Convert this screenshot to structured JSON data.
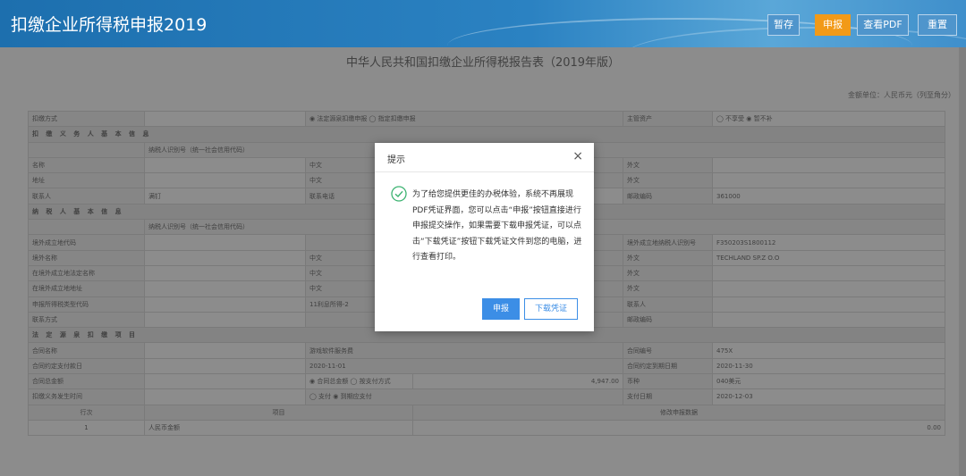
{
  "app": {
    "title": "扣缴企业所得税申报2019"
  },
  "toolbar": {
    "save": "暂存",
    "submit": "申报",
    "view_pdf": "查看PDF",
    "reset": "重置"
  },
  "report": {
    "title": "中华人民共和国扣缴企业所得税报告表（2019年版）",
    "unit_note": "金额单位：人民币元（列至角分）",
    "rows": [
      {
        "label": "扣缴方式",
        "mid": "◉ 法定源泉扣缴申报  ◯ 指定扣缴申报",
        "right_label": "主管资产",
        "right_value": "◯ 不享受  ◉ 暂不补"
      },
      {
        "section": "扣 缴 义 务 人 基 本 信 息"
      },
      {
        "sub": "纳税人识别号（统一社会信用代码）"
      },
      {
        "label": "名称",
        "mid": "中文",
        "right_label": "外文",
        "right_value": ""
      },
      {
        "label": "地址",
        "mid": "中文",
        "right_label": "外文",
        "right_value": ""
      },
      {
        "label": "联系人",
        "contact": "满钉",
        "mid": "联系电话",
        "right_label": "邮政编码",
        "right_value": "361000"
      },
      {
        "section": "纳 税 人 基 本 信 息"
      },
      {
        "sub": "纳税人识别号（统一社会信用代码）"
      },
      {
        "label": "境外成立地代码",
        "mid": "",
        "right_label": "境外成立地纳税人识别号",
        "right_value": "F350203S1800112"
      },
      {
        "label": "境外名称",
        "mid": "中文",
        "right_label": "外文",
        "right_value": "TECHLAND SP.Z O.O"
      },
      {
        "label": "在境外成立地法定名称",
        "mid": "中文",
        "right_label": "外文",
        "right_value": ""
      },
      {
        "label": "在境外成立地地址",
        "mid": "中文",
        "right_label": "外文",
        "right_value": ""
      },
      {
        "label": "申报所得税类型代码",
        "mid": "11利息所得-2",
        "right_label": "联系人",
        "right_value": ""
      },
      {
        "label": "联系方式",
        "mid": "",
        "right_label": "邮政编码",
        "right_value": ""
      },
      {
        "section": "法 定 源 泉 扣 缴 项 目"
      },
      {
        "label": "合同名称",
        "mid": "游戏软件服务费",
        "right_label": "合同编号",
        "right_value": "475X"
      },
      {
        "label": "合同约定支付款日",
        "mid": "2020-11-01",
        "right_label": "合同约定到期日期",
        "right_value": "2020-11-30"
      },
      {
        "label": "合同总金额",
        "mid": "◉ 合同总金额  ◯ 按支付方式",
        "amount": "4,947.00",
        "right_label": "币种",
        "right_value": "040美元"
      },
      {
        "label": "扣缴义务发生时间",
        "mid": "◯ 支付  ◉ 到期应支付",
        "right_label": "支付日期",
        "right_value": "2020-12-03"
      }
    ],
    "bottom": {
      "col_no": "行次",
      "col_item": "项目",
      "col_amount": "修改申报数据",
      "row_no": "1",
      "row_item": "人民币金额",
      "row_amount": "0.00"
    }
  },
  "dialog": {
    "title": "提示",
    "close": "×",
    "message": "为了给您提供更佳的办税体验，系统不再展现PDF凭证界面，您可以点击“申报”按钮直接进行申报提交操作，如果需要下载申报凭证，可以点击“下载凭证”按钮下载凭证文件到您的电脑，进行查看打印。",
    "primary_button": "申报",
    "secondary_button": "下载凭证"
  },
  "colors": {
    "header_blue": "#2b82c2",
    "accent_orange": "#f29a18",
    "button_blue": "#3c8ee6",
    "success_green": "#3cb371"
  }
}
